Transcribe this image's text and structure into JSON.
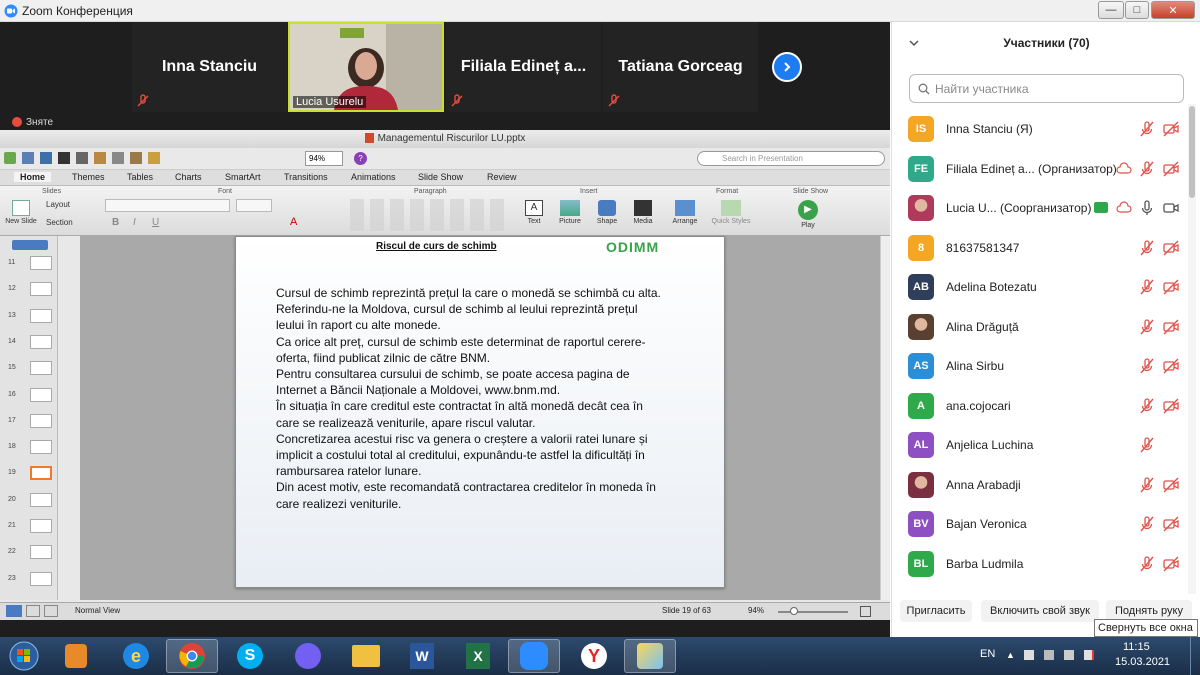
{
  "window": {
    "title": "Zoom Конференция"
  },
  "video_strip": {
    "tiles": [
      {
        "name": "Inna Stanciu"
      },
      {
        "name": "Lucia Usurelu"
      },
      {
        "name": "Filiala Edineț a..."
      },
      {
        "name": "Tatiana Gorceag"
      }
    ],
    "next_icon": "chevron-right-icon"
  },
  "share_label": "Зняте",
  "ppt": {
    "file_title": "Managementul Riscurilor LU.pptx",
    "zoom": "94%",
    "search_placeholder": "Search in Presentation",
    "tabs": [
      "Home",
      "Themes",
      "Tables",
      "Charts",
      "SmartArt",
      "Transitions",
      "Animations",
      "Slide Show",
      "Review"
    ],
    "groups": [
      "Slides",
      "Font",
      "Paragraph",
      "Insert",
      "Format",
      "Slide Show"
    ],
    "ribbon_labels": {
      "new_slide": "New Slide",
      "layout": "Layout",
      "section": "Section",
      "text": "Text",
      "picture": "Picture",
      "shape": "Shape",
      "media": "Media",
      "arrange": "Arrange",
      "quick_styles": "Quick Styles",
      "play": "Play"
    },
    "thumb_numbers": [
      "11",
      "12",
      "13",
      "14",
      "15",
      "16",
      "17",
      "18",
      "19",
      "20",
      "21",
      "22",
      "23"
    ],
    "slide": {
      "title": "Riscul de curs de schimb",
      "logo": "ODIMM",
      "lines": [
        "Cursul de schimb reprezintă prețul la care o monedă se schimbă cu alta.",
        "Referindu-ne la Moldova, cursul de schimb al leului reprezintă prețul",
        "leului în raport cu alte monede.",
        "Ca orice alt preț, cursul de schimb este determinat de raportul cerere-",
        "oferta, fiind publicat zilnic de către BNM.",
        "Pentru consultarea cursului de schimb, se poate accesa pagina de",
        "Internet a Băncii Naționale a Moldovei, www.bnm.md.",
        "În situația în care creditul este contractat în altă monedă decât cea în",
        "care se realizează veniturile, apare riscul valutar.",
        "Concretizarea acestui risc va genera o creștere a valorii ratei lunare și",
        "implicit a costului total al creditului, expunându-te astfel la dificultăți în",
        "rambursarea ratelor lunare.",
        "Din acest motiv, este recomandată contractarea creditelor în moneda în",
        "care realizezi veniturile."
      ]
    },
    "status": {
      "view": "Normal View",
      "slide_of": "Slide 19 of 63",
      "zoom": "94%"
    }
  },
  "participants": {
    "header": "Участники (70)",
    "search_placeholder": "Найти участника",
    "items": [
      {
        "initials": "IS",
        "name": "Inna Stanciu (Я)",
        "color": "#f5a623"
      },
      {
        "initials": "FE",
        "name": "Filiala Edineț a... (Организатор)",
        "color": "#2eaa8a"
      },
      {
        "initials": "",
        "name": "Lucia U... (Соорганизатор)",
        "color": "#b03a5b"
      },
      {
        "initials": "8",
        "name": "81637581347",
        "color": "#f5a623"
      },
      {
        "initials": "AB",
        "name": "Adelina Botezatu",
        "color": "#2f3e5a"
      },
      {
        "initials": "",
        "name": "Alina Drăguță",
        "color": "#5a4030"
      },
      {
        "initials": "AS",
        "name": "Alina Sirbu",
        "color": "#2b8fd6"
      },
      {
        "initials": "A",
        "name": "ana.cojocari",
        "color": "#2eaa4a"
      },
      {
        "initials": "AL",
        "name": "Anjelica Luchina",
        "color": "#8e4fc2"
      },
      {
        "initials": "",
        "name": "Anna Arabadji",
        "color": "#7a3040"
      },
      {
        "initials": "BV",
        "name": "Bajan Veronica",
        "color": "#8e4fc2"
      },
      {
        "initials": "BL",
        "name": "Barba Ludmila",
        "color": "#2eaa4a"
      }
    ],
    "buttons": {
      "invite": "Пригласить",
      "unmute": "Включить свой звук",
      "raise": "Поднять руку"
    },
    "tooltip": "Свернуть все окна"
  },
  "taskbar": {
    "lang": "EN",
    "time": "11:15",
    "date": "15.03.2021",
    "apps": [
      "start-orb-icon",
      "media-player-icon",
      "internet-explorer-icon",
      "chrome-icon",
      "skype-icon",
      "viber-icon",
      "file-explorer-icon",
      "word-icon",
      "excel-icon",
      "zoom-icon",
      "yandex-icon",
      "paint-icon"
    ]
  }
}
